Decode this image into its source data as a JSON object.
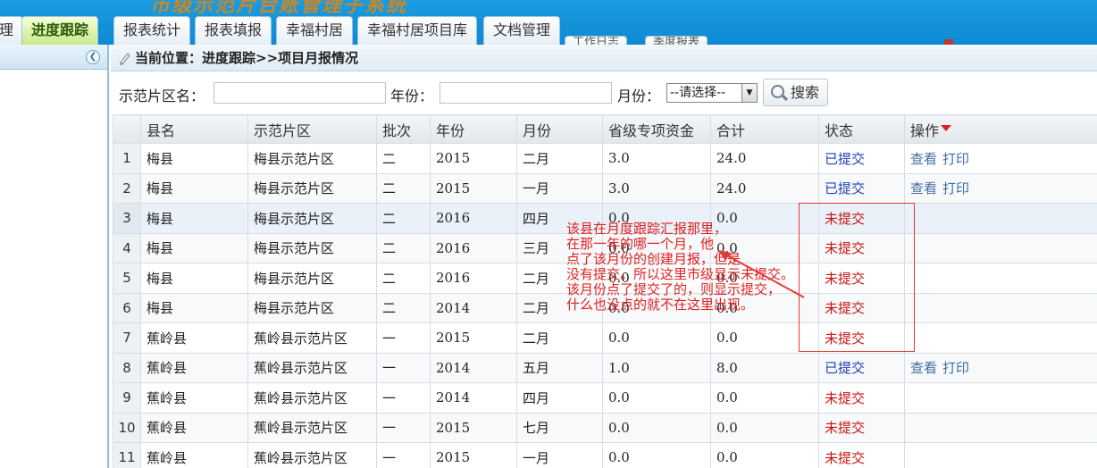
{
  "app": {
    "title": "市级示范片台账管理子系统"
  },
  "tabs": [
    {
      "label": "理"
    },
    {
      "label": "进度跟踪"
    },
    {
      "label": "报表统计"
    },
    {
      "label": "报表填报"
    },
    {
      "label": "幸福村居"
    },
    {
      "label": "幸福村居项目库"
    },
    {
      "label": "文档管理"
    }
  ],
  "sub_tabs": [
    {
      "label": "工作日志"
    },
    {
      "label": "季度报表"
    }
  ],
  "breadcrumb": {
    "text": "当前位置：进度跟踪>>项目月报情况"
  },
  "search": {
    "district_label": "示范片区名：",
    "district_value": "",
    "year_label": "年份：",
    "year_value": "",
    "month_label": "月份：",
    "month_selected": "--请选择--",
    "button_label": "搜索"
  },
  "table": {
    "headers": [
      "县名",
      "示范片区",
      "批次",
      "年份",
      "月份",
      "省级专项资金",
      "合计",
      "状态",
      "操作"
    ],
    "rows": [
      {
        "n": "1",
        "county": "梅县",
        "district": "梅县示范片区",
        "batch": "二",
        "year": "2015",
        "month": "二月",
        "fund": "3.0",
        "total": "24.0",
        "status": "已提交",
        "view": "查看",
        "print": "打印"
      },
      {
        "n": "2",
        "county": "梅县",
        "district": "梅县示范片区",
        "batch": "二",
        "year": "2015",
        "month": "一月",
        "fund": "3.0",
        "total": "24.0",
        "status": "已提交",
        "view": "查看",
        "print": "打印"
      },
      {
        "n": "3",
        "county": "梅县",
        "district": "梅县示范片区",
        "batch": "二",
        "year": "2016",
        "month": "四月",
        "fund": "0.0",
        "total": "0.0",
        "status": "未提交"
      },
      {
        "n": "4",
        "county": "梅县",
        "district": "梅县示范片区",
        "batch": "二",
        "year": "2016",
        "month": "三月",
        "fund": "0.0",
        "total": "0.0",
        "status": "未提交"
      },
      {
        "n": "5",
        "county": "梅县",
        "district": "梅县示范片区",
        "batch": "二",
        "year": "2016",
        "month": "二月",
        "fund": "0.0",
        "total": "0.0",
        "status": "未提交"
      },
      {
        "n": "6",
        "county": "梅县",
        "district": "梅县示范片区",
        "batch": "二",
        "year": "2014",
        "month": "二月",
        "fund": "0.0",
        "total": "0.0",
        "status": "未提交"
      },
      {
        "n": "7",
        "county": "蕉岭县",
        "district": "蕉岭县示范片区",
        "batch": "一",
        "year": "2015",
        "month": "二月",
        "fund": "0.0",
        "total": "0.0",
        "status": "未提交"
      },
      {
        "n": "8",
        "county": "蕉岭县",
        "district": "蕉岭县示范片区",
        "batch": "一",
        "year": "2014",
        "month": "五月",
        "fund": "1.0",
        "total": "8.0",
        "status": "已提交",
        "view": "查看",
        "print": "打印"
      },
      {
        "n": "9",
        "county": "蕉岭县",
        "district": "蕉岭县示范片区",
        "batch": "一",
        "year": "2014",
        "month": "四月",
        "fund": "0.0",
        "total": "0.0",
        "status": "未提交"
      },
      {
        "n": "10",
        "county": "蕉岭县",
        "district": "蕉岭县示范片区",
        "batch": "一",
        "year": "2015",
        "month": "七月",
        "fund": "0.0",
        "total": "0.0",
        "status": "未提交"
      },
      {
        "n": "11",
        "county": "蕉岭县",
        "district": "蕉岭县示范片区",
        "batch": "一",
        "year": "2015",
        "month": "一月",
        "fund": "0.0",
        "total": "0.0",
        "status": "未提交"
      }
    ]
  },
  "annotation": {
    "lines": [
      "该县在月度跟踪汇报那里，",
      "在那一年的哪一个月，他",
      "点了该月份的创建月报，但是",
      "没有提交。所以这里市级显示未提交。",
      "该月份点了提交了的，则显示提交，",
      "什么也没点的就不在这里出现。"
    ]
  },
  "colors": {
    "submitted": "#1f3fb5",
    "not_submitted": "#cc1111",
    "annotation": "#e02020",
    "banner": "#1b9ce0"
  }
}
